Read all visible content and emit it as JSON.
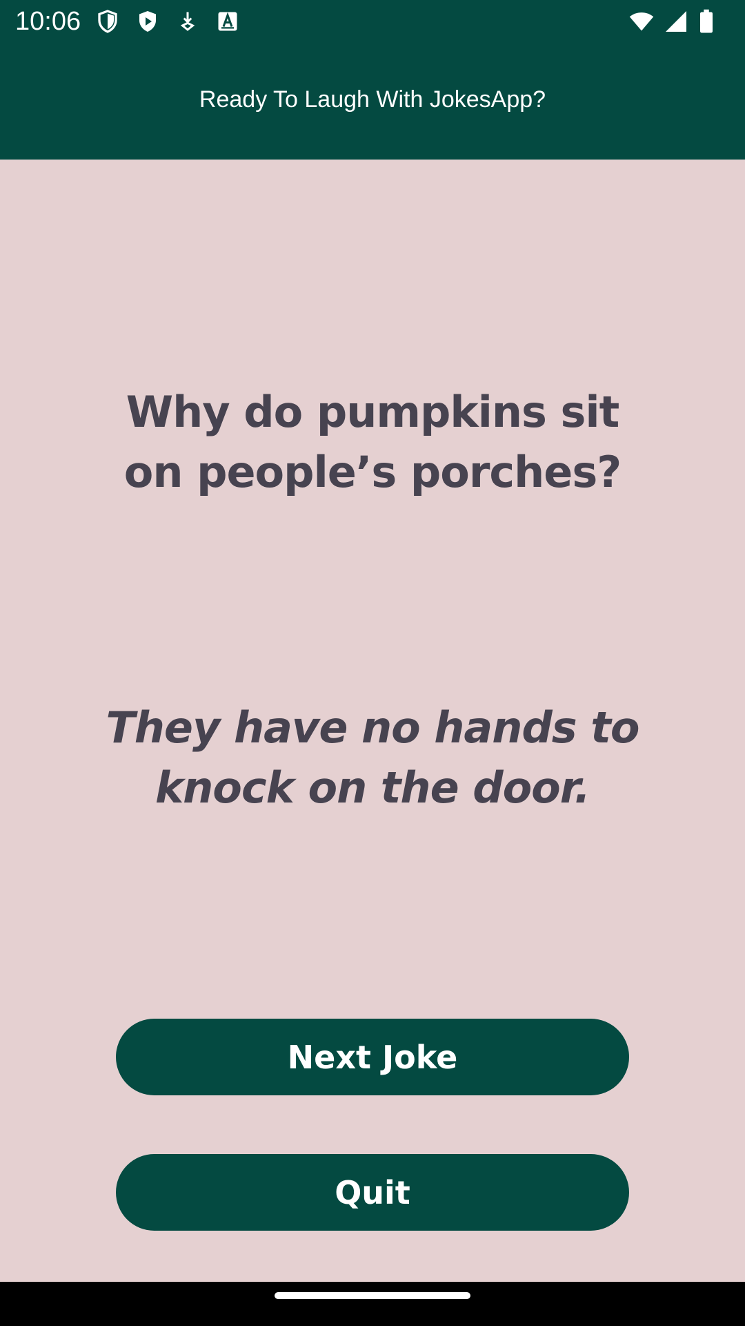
{
  "status_bar": {
    "time": "10:06",
    "icons_left": [
      "shield-icon",
      "play-shield-icon",
      "download-icon",
      "font-a-icon"
    ],
    "icons_right": [
      "wifi-icon",
      "signal-icon",
      "battery-icon"
    ]
  },
  "app_bar": {
    "title": "Ready To Laugh With JokesApp?"
  },
  "joke": {
    "question": "Why do pumpkins sit on people’s porches?",
    "answer": "They have no hands to knock on the door."
  },
  "actions": {
    "next_label": "Next Joke",
    "quit_label": "Quit"
  },
  "colors": {
    "primary": "#044a41",
    "background": "#e5d0d1",
    "text": "#474350"
  }
}
